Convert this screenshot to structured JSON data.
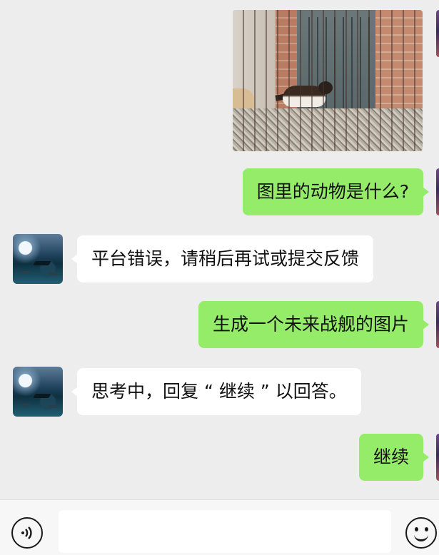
{
  "messages": [
    {
      "id": "m1",
      "side": "right",
      "type": "image",
      "image_desc": "bird-in-cage-photo"
    },
    {
      "id": "m2",
      "side": "right",
      "type": "text",
      "text": "图里的动物是什么?"
    },
    {
      "id": "m3",
      "side": "left",
      "type": "text",
      "text": "平台错误，请稍后再试或提交反馈"
    },
    {
      "id": "m4",
      "side": "right",
      "type": "text",
      "text": "生成一个未来战舰的图片"
    },
    {
      "id": "m5",
      "side": "left",
      "type": "text",
      "text": "思考中，回复 “ 继续 ” 以回答。"
    },
    {
      "id": "m6",
      "side": "right",
      "type": "text",
      "text": "继续"
    }
  ],
  "input_bar": {
    "input_value": "",
    "left_icon": "voice-icon",
    "right_icon": "emoji-icon"
  },
  "colors": {
    "background": "#ededed",
    "outgoing_bubble": "#95ec69",
    "incoming_bubble": "#ffffff"
  }
}
